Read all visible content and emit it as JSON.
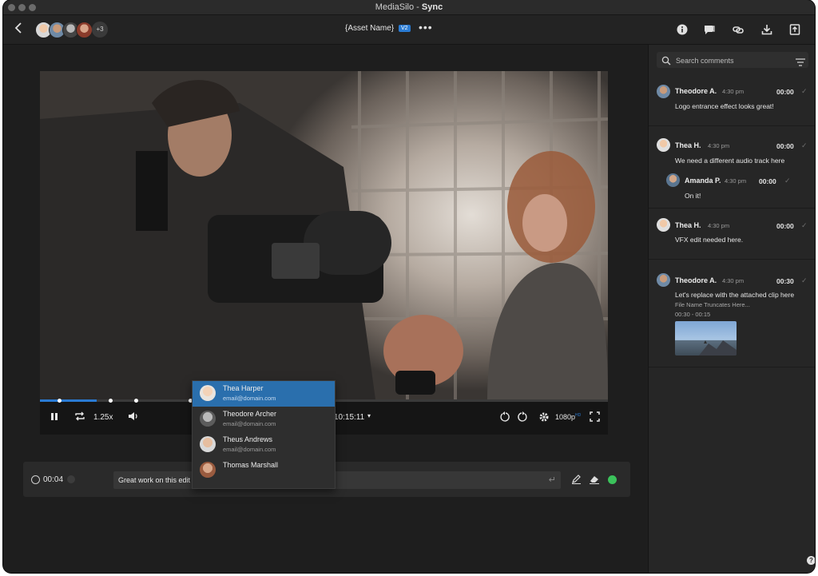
{
  "window": {
    "app_name": "MediaSilo",
    "separator": " - ",
    "section": "Sync"
  },
  "toolbar": {
    "asset_name": "{Asset Name}",
    "version_badge": "V2",
    "more_dots": "•••",
    "extra_viewers": "+3",
    "icons": [
      "back-icon",
      "info-icon",
      "chat-icon",
      "link-icon",
      "download-icon",
      "upload-icon"
    ]
  },
  "player": {
    "speed": "1.25x",
    "timecode": "10:15:11",
    "quality": "1080p",
    "quality_sub": "HD",
    "progress_fraction": 0.1
  },
  "mention_dropdown": [
    {
      "name": "Thea Harper",
      "email": "email@domain.com",
      "active": true
    },
    {
      "name": "Theodore Archer",
      "email": "email@domain.com"
    },
    {
      "name": "Theus Andrews",
      "email": "email@domain.com"
    },
    {
      "name": "Thomas Marshall",
      "email": ""
    }
  ],
  "comment_bar": {
    "timestamp": "00:04",
    "input_value": "Great work on this edit @T"
  },
  "sidebar": {
    "search_placeholder": "Search comments",
    "comments": [
      {
        "name": "Theodore A.",
        "time": "4:30 pm",
        "stamp": "00:00",
        "text": "Logo entrance effect looks great!"
      },
      {
        "name": "Thea H.",
        "time": "4:30 pm",
        "stamp": "00:00",
        "text": "We need a different audio track here",
        "reply": {
          "name": "Amanda P.",
          "time": "4:30 pm",
          "stamp": "00:00",
          "text": "On it!"
        }
      },
      {
        "name": "Thea H.",
        "time": "4:30 pm",
        "stamp": "00:00",
        "text": "VFX edit needed here."
      },
      {
        "name": "Theodore A.",
        "time": "4:30 pm",
        "stamp": "00:30",
        "text": "Let's replace with the attached clip here",
        "attachment_name": "File Name Truncates Here...",
        "attachment_range": "00:30 - 00:15"
      }
    ],
    "help": "?"
  },
  "colors": {
    "accent": "#2a7bd3",
    "online": "#3bc25b",
    "panel": "#262626",
    "stage": "#1e1e1e"
  }
}
